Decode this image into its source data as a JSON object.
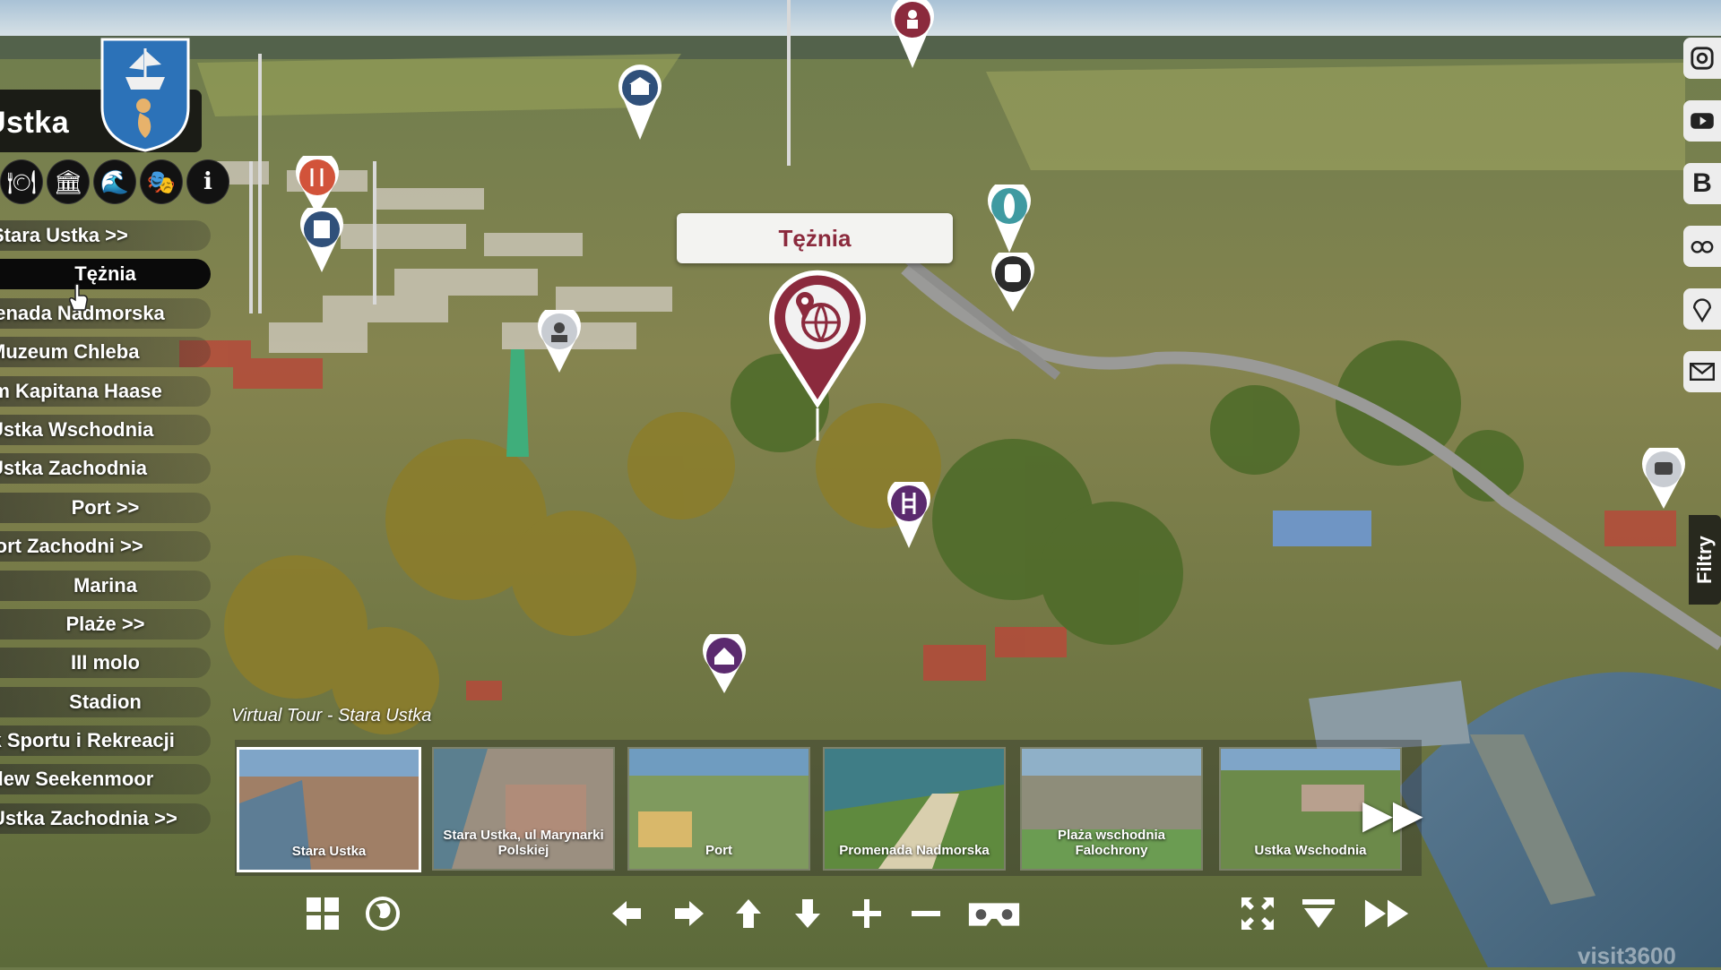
{
  "brand": {
    "title": "Ustka",
    "crest_icon": "ship-mermaid-crest"
  },
  "colors": {
    "accent": "#8b2a3d",
    "menu_bg": "#121212",
    "tooltip_bg": "#f3f3f1"
  },
  "categories": [
    {
      "icon": "restaurant-icon"
    },
    {
      "icon": "museum-icon"
    },
    {
      "icon": "beach-icon"
    },
    {
      "icon": "theatre-icon"
    },
    {
      "icon": "info-icon"
    }
  ],
  "menu": {
    "items": [
      {
        "label": "Stara Ustka >>"
      },
      {
        "label": "Tężnia",
        "active": true
      },
      {
        "label": "Promenada Nadmorska"
      },
      {
        "label": "Muzeum Chleba"
      },
      {
        "label": "Dom Kapitana Haase"
      },
      {
        "label": "Ustka Wschodnia"
      },
      {
        "label": "Ustka Zachodnia"
      },
      {
        "label": "Port >>"
      },
      {
        "label": "Port Zachodni >>"
      },
      {
        "label": "Marina"
      },
      {
        "label": "Plaże >>"
      },
      {
        "label": "III molo"
      },
      {
        "label": "Stadion"
      },
      {
        "label": "Park Sportu i Rekreacji"
      },
      {
        "label": "Zalew Seekenmoor"
      },
      {
        "label": "Ustka Zachodnia >>"
      }
    ]
  },
  "tooltip": {
    "label": "Tężnia"
  },
  "socials": [
    {
      "icon": "instagram-icon",
      "label": ""
    },
    {
      "icon": "youtube-icon",
      "label": ""
    },
    {
      "icon": "booking-icon",
      "label": "B"
    },
    {
      "icon": "tripadvisor-icon",
      "label": ""
    },
    {
      "icon": "map-pin-icon",
      "label": ""
    },
    {
      "icon": "mail-icon",
      "label": ""
    }
  ],
  "filters": {
    "label": "Filtry"
  },
  "tour": {
    "label": "Virtual Tour - Stara Ustka",
    "thumbnails": [
      {
        "caption": "Stara Ustka",
        "selected": true
      },
      {
        "caption": "Stara Ustka, ul Marynarki Polskiej"
      },
      {
        "caption": "Port"
      },
      {
        "caption": "Promenada Nadmorska"
      },
      {
        "caption": "Plaża wschodnia Falochrony"
      },
      {
        "caption": "Ustka Wschodnia"
      }
    ],
    "next_icon": "fast-forward-icon"
  },
  "controls": [
    {
      "icon": "grid-icon"
    },
    {
      "icon": "globe-icon"
    },
    {
      "icon": "arrow-left-icon"
    },
    {
      "icon": "arrow-right-icon"
    },
    {
      "icon": "arrow-up-icon"
    },
    {
      "icon": "arrow-down-icon"
    },
    {
      "icon": "zoom-in-icon"
    },
    {
      "icon": "zoom-out-icon"
    },
    {
      "icon": "vr-headset-icon"
    },
    {
      "icon": "fullscreen-icon"
    },
    {
      "icon": "hide-thumbnails-icon"
    },
    {
      "icon": "autoplay-icon"
    }
  ],
  "watermark": "visit3600"
}
